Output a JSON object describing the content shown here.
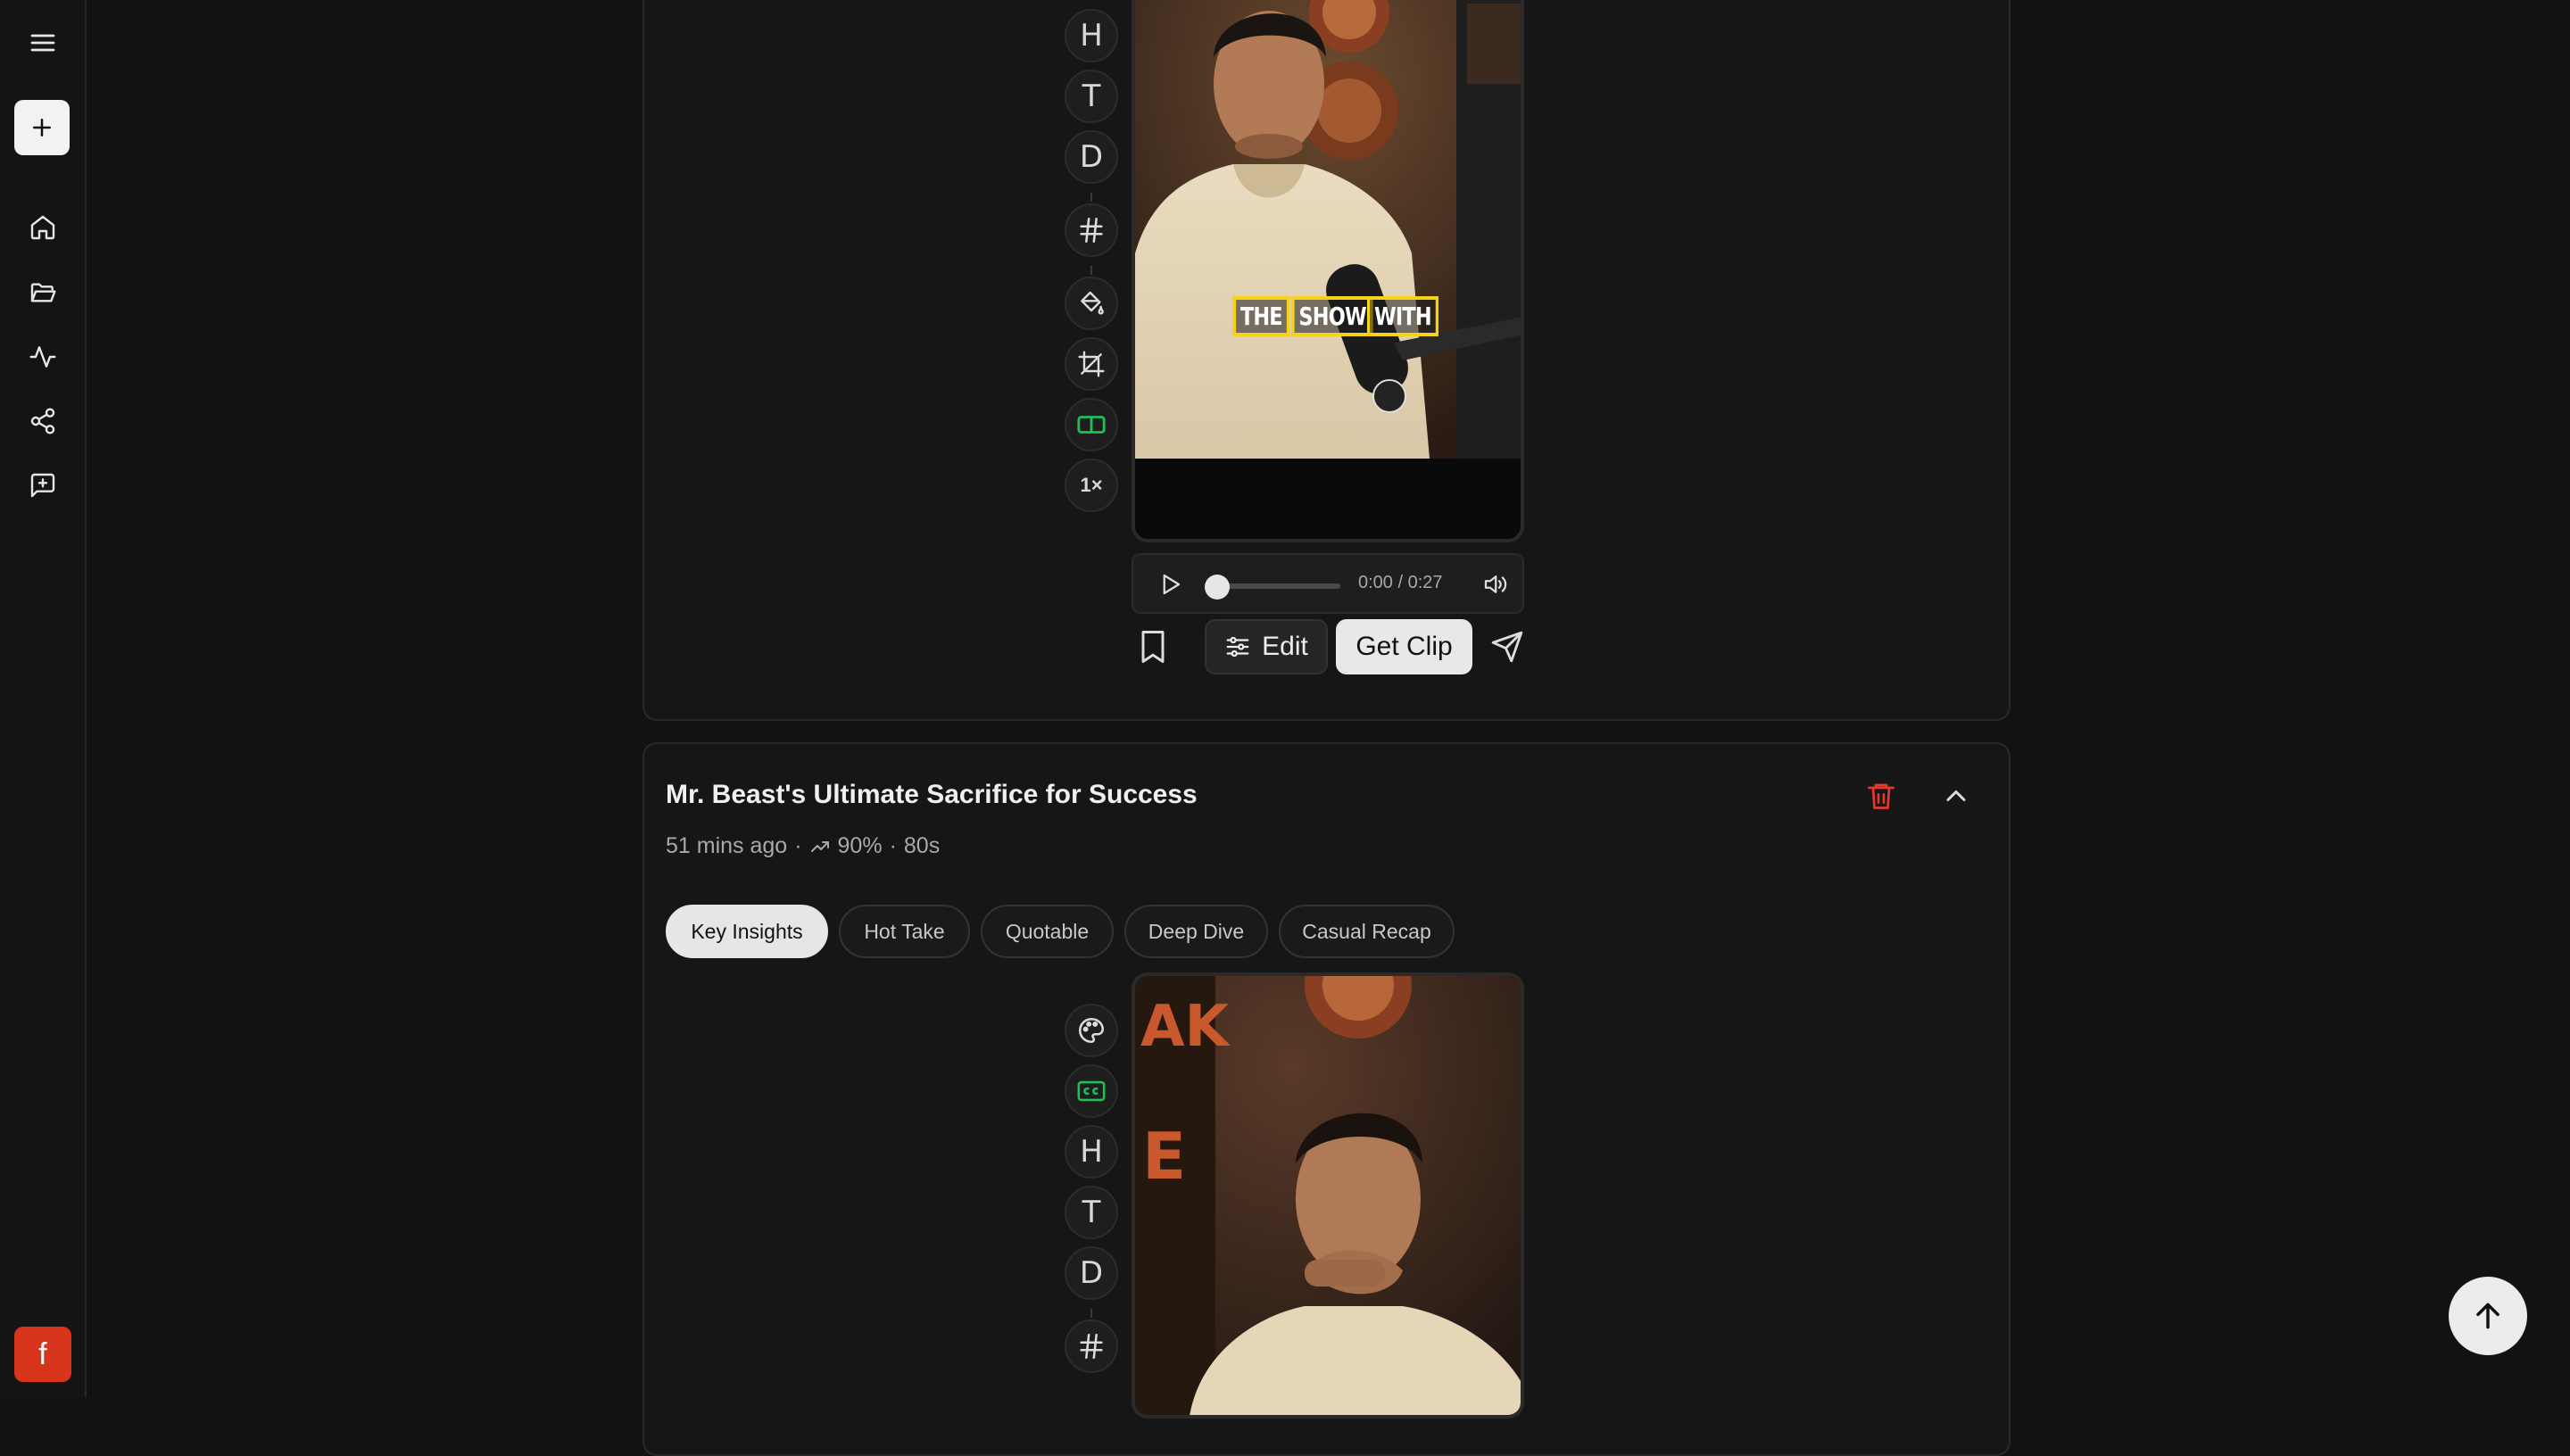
{
  "sidebar": {
    "icons": [
      "menu-icon",
      "plus-icon",
      "home-icon",
      "folder-icon",
      "activity-icon",
      "share-icon",
      "feedback-icon"
    ],
    "avatar_letter": "f"
  },
  "clip1": {
    "tools": [
      "H",
      "T",
      "D",
      "1×"
    ],
    "caption_words": [
      "THE",
      "SHOW",
      "WITH"
    ],
    "player": {
      "time": "0:00 / 0:27"
    },
    "edit_label": "Edit",
    "get_clip_label": "Get Clip"
  },
  "clip2": {
    "title": "Mr. Beast's Ultimate Sacrifice for Success",
    "meta_time": "51 mins ago",
    "meta_score": "90%",
    "meta_duration": "80s",
    "tabs": [
      "Key Insights",
      "Hot Take",
      "Quotable",
      "Deep Dive",
      "Casual Recap"
    ],
    "active_tab": "Key Insights",
    "tools": [
      "H",
      "T",
      "D"
    ],
    "backdrop_letters": [
      "AK",
      "E"
    ]
  },
  "colors": {
    "accent_green": "#1fbf5a",
    "delete_red": "#e5392b",
    "avatar": "#d7341b",
    "caption_border": "#f4d31a"
  }
}
